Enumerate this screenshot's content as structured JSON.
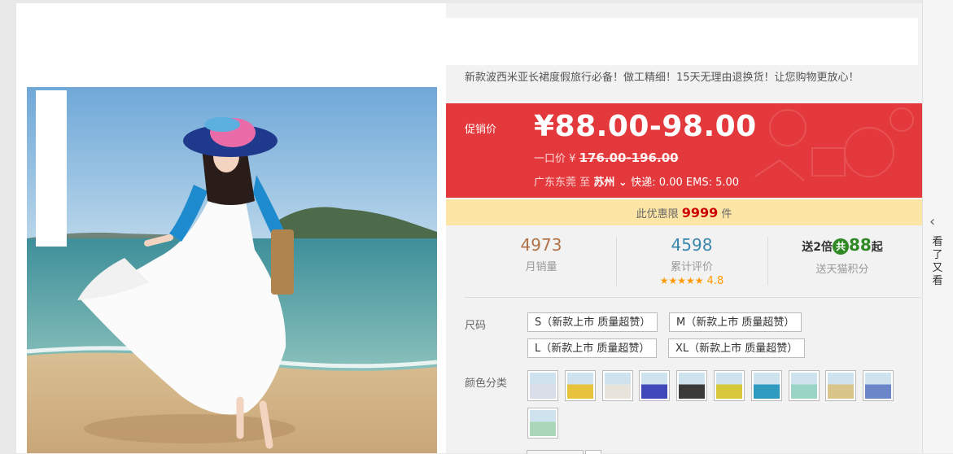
{
  "product": {
    "subtitle": "新款波西米亚长裙度假旅行必备！做工精细！15天无理由退换货！让您购物更放心！",
    "image_alt": "white bohemian long dress on beach"
  },
  "price": {
    "promo_label": "促销价",
    "current": "¥88.00-98.00",
    "original_label": "一口价",
    "original_currency": "¥",
    "original_value": "176.00-196.00",
    "ship_from": "广东东莞",
    "ship_to_word": "至",
    "ship_to_city": "苏州",
    "shipping": "快递: 0.00 EMS: 5.00"
  },
  "promo": {
    "prefix": "此优惠限",
    "limit": "9999",
    "suffix": "件"
  },
  "stats": {
    "sales_value": "4973",
    "sales_label": "月销量",
    "reviews_value": "4598",
    "reviews_label": "累计评价",
    "rating": "4.8",
    "rating_stars": "★★★★★",
    "points_prefix": "送2倍",
    "points_badge": "共",
    "points_value": "88",
    "points_suffix": "起",
    "points_label": "送天猫积分"
  },
  "options": {
    "size_label": "尺码",
    "sizes": [
      "S（新款上市 质量超赞）",
      "M（新款上市 质量超赞）",
      "L（新款上市 质量超赞）",
      "XL（新款上市 质量超赞）"
    ],
    "color_label": "颜色分类",
    "swatch_colors": [
      "#d8dde8",
      "#e8c23a",
      "#e8e4dc",
      "#4047b8",
      "#3a3a3a",
      "#d7c83a",
      "#2f9ac0",
      "#9ad4c4",
      "#d9c48a",
      "#6a86c8",
      "#a9d7b8"
    ]
  },
  "sidebar": {
    "arrow": "‹",
    "label": "看了又看"
  },
  "colors": {
    "price_red": "#e4393c",
    "promo_yellow": "#fde6a5",
    "points_green": "#2f8a26"
  }
}
